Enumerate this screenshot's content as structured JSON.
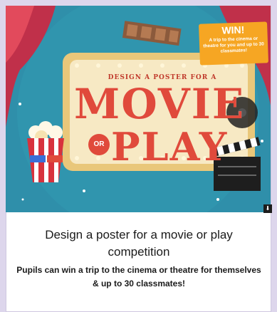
{
  "banner": {
    "kicker": "DESIGN A POSTER FOR A",
    "word1": "MOVIE",
    "connector": "OR",
    "word2": "PLAY",
    "win_title": "WIN!",
    "win_desc": "A trip to the cinema or theatre for you and up to 30 classmates!"
  },
  "download_icon": "download-icon",
  "card": {
    "title": "Design a poster for a movie or play competition",
    "description": "Pupils can win a trip to the cinema or theatre for themselves & up to 30 classmates!"
  },
  "colors": {
    "page_bg": "#ddd6ec",
    "banner_bg": "#2c8aa6",
    "marquee": "#f7e3b0",
    "accent_red": "#e04a3b",
    "win_orange": "#f6a623"
  }
}
